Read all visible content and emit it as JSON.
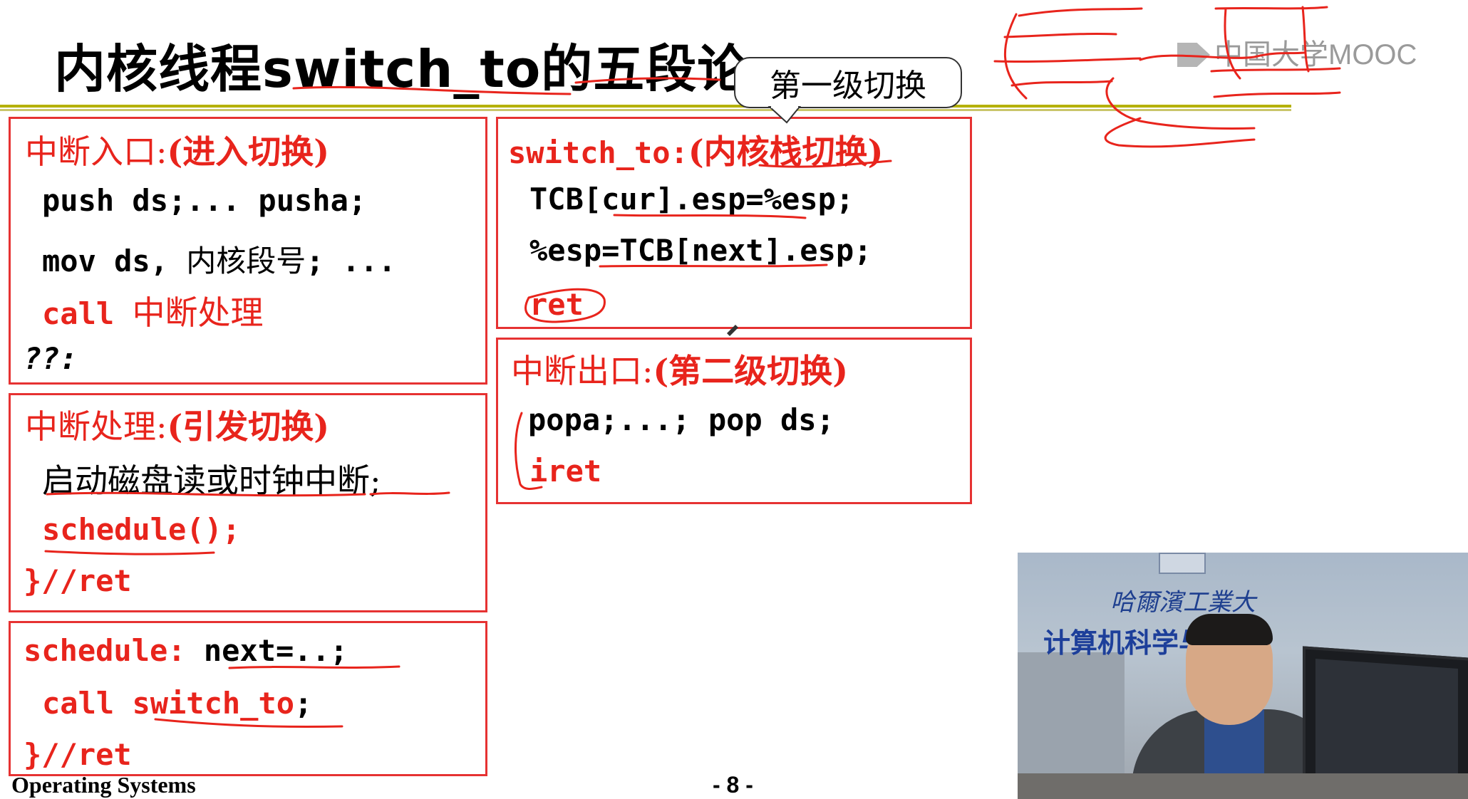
{
  "slide": {
    "title": "内核线程switch_to的五段论",
    "callout": "第一级切换",
    "logo": "中国大学MOOC",
    "footer_left": "Operating Systems",
    "page_number": "- 8 -"
  },
  "box_interrupt_entry": {
    "header_cn": "中断入口:",
    "header_note": "(进入切换)",
    "l1": "push ds;... pusha;",
    "l2_a": "mov ds, ",
    "l2_cn": "内核段号",
    "l2_b": "; ...",
    "l3_kw": "call ",
    "l3_cn": "中断处理",
    "l4": "??:"
  },
  "box_interrupt_handler": {
    "header_cn": "中断处理:",
    "header_note": "(引发切换)",
    "l1": "启动磁盘读或时钟中断;",
    "l2": "schedule();",
    "l3": "}//ret"
  },
  "box_schedule": {
    "l1_kw": "schedule: ",
    "l1_rest": "next=..;",
    "l2_kw": "call ",
    "l2_fn": "switch_to",
    "l2_end": ";",
    "l3": "}//ret"
  },
  "box_switch_to": {
    "header": "switch_to:",
    "header_note": "(内核栈切换)",
    "l1": "TCB[cur].esp=%esp;",
    "l2": "%esp=TCB[next].esp;",
    "l3": "ret"
  },
  "box_interrupt_exit": {
    "header_cn": "中断出口:",
    "header_note": "(第二级切换)",
    "l1": "popa;...; pop ds;",
    "l2": "iret"
  },
  "video": {
    "banner_top": "哈爾濱工業大",
    "banner_main": "计算机科学与技    院"
  },
  "colors": {
    "accent_red": "#e8241c",
    "box_border": "#e63232",
    "title_rule": "#b5b100"
  }
}
